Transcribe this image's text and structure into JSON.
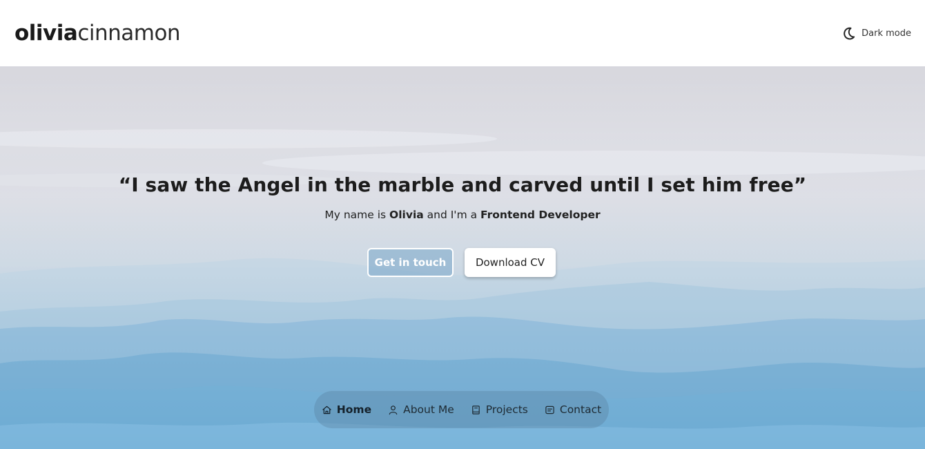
{
  "header": {
    "logo_strong": "olivia",
    "logo_light": "cinnamon",
    "dark_mode_label": "Dark mode",
    "dark_mode_icon": "moon-icon"
  },
  "hero": {
    "quote": "“I saw the Angel in the marble and carved until I set him free”",
    "intro_prefix": "My name is ",
    "intro_name": "Olivia",
    "intro_middle": " and I'm a ",
    "intro_role": "Frontend Developer",
    "primary_button": "Get in touch",
    "secondary_button": "Download CV"
  },
  "nav": {
    "items": [
      {
        "label": "Home",
        "icon": "home-icon",
        "active": true
      },
      {
        "label": "About Me",
        "icon": "user-icon",
        "active": false
      },
      {
        "label": "Projects",
        "icon": "book-icon",
        "active": false
      },
      {
        "label": "Contact",
        "icon": "message-icon",
        "active": false
      }
    ]
  },
  "colors": {
    "sky_top": "#c2c2cc",
    "mountain_blue": "#6fb0d6",
    "text_dark": "#1c1c1c",
    "nav_bg": "rgba(90,130,160,0.38)"
  }
}
